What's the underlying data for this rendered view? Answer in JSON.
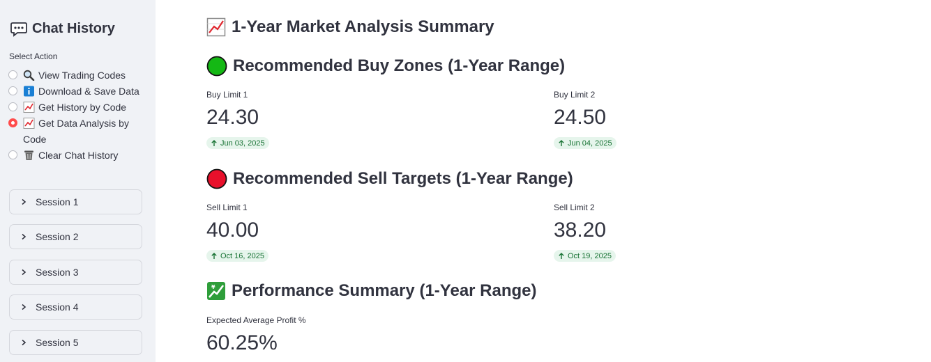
{
  "sidebar": {
    "title": "Chat History",
    "select_label": "Select Action",
    "options": [
      {
        "label": "View Trading Codes",
        "icon": "magnifier-icon",
        "checked": false
      },
      {
        "label": "Download & Save Data",
        "icon": "info-icon",
        "checked": false
      },
      {
        "label": "Get History by Code",
        "icon": "chart-increasing-icon",
        "checked": false
      },
      {
        "label": "Get Data Analysis by Code",
        "icon": "chart-increasing-icon",
        "checked": true
      },
      {
        "label": "Clear Chat History",
        "icon": "wastebasket-icon",
        "checked": false
      }
    ],
    "sessions": [
      "Session 1",
      "Session 2",
      "Session 3",
      "Session 4",
      "Session 5"
    ]
  },
  "main": {
    "title": "1-Year Market Analysis Summary",
    "buy_section": {
      "heading": "Recommended Buy Zones (1-Year Range)",
      "metrics": [
        {
          "label": "Buy Limit 1",
          "value": "24.30",
          "delta": "Jun 03, 2025"
        },
        {
          "label": "Buy Limit 2",
          "value": "24.50",
          "delta": "Jun 04, 2025"
        }
      ]
    },
    "sell_section": {
      "heading": "Recommended Sell Targets (1-Year Range)",
      "metrics": [
        {
          "label": "Sell Limit 1",
          "value": "40.00",
          "delta": "Oct 16, 2025"
        },
        {
          "label": "Sell Limit 2",
          "value": "38.20",
          "delta": "Oct 19, 2025"
        }
      ]
    },
    "performance_section": {
      "heading": "Performance Summary (1-Year Range)",
      "metrics": [
        {
          "label": "Expected Average Profit %",
          "value": "60.25%"
        }
      ]
    }
  },
  "colors": {
    "accent": "#ff4b4b",
    "sidebar_bg": "#f0f2f6",
    "delta_bg": "#e6f5ec",
    "delta_text": "#177233",
    "green_circle": "#14b814",
    "red_circle": "#e8102b"
  }
}
